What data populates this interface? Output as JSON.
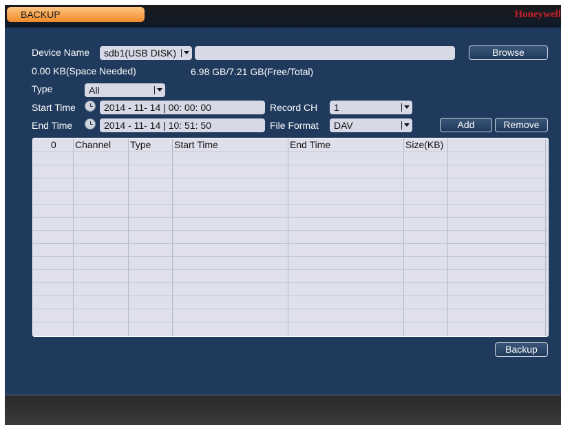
{
  "window": {
    "title": "BACKUP",
    "brand": "Honeywell"
  },
  "device": {
    "label": "Device Name",
    "value": "sdb1(USB DISK)",
    "path_value": "",
    "browse_label": "Browse",
    "space_needed": "0.00 KB(Space Needed)",
    "free_total": "6.98 GB/7.21 GB(Free/Total)"
  },
  "type": {
    "label": "Type",
    "value": "All"
  },
  "start_time": {
    "label": "Start Time",
    "value": "2014  -  11-  14 |  00:  00:  00"
  },
  "end_time": {
    "label": "End Time",
    "value": "2014  -  11-  14 |  10:  51:  50"
  },
  "record_ch": {
    "label": "Record CH",
    "value": "1"
  },
  "file_format": {
    "label": "File Format",
    "value": "DAV"
  },
  "buttons": {
    "add": "Add",
    "remove": "Remove",
    "backup": "Backup"
  },
  "table": {
    "columns": [
      "0",
      "Channel",
      "Type",
      "Start Time",
      "End Time",
      "Size(KB)",
      ""
    ],
    "rows": []
  }
}
